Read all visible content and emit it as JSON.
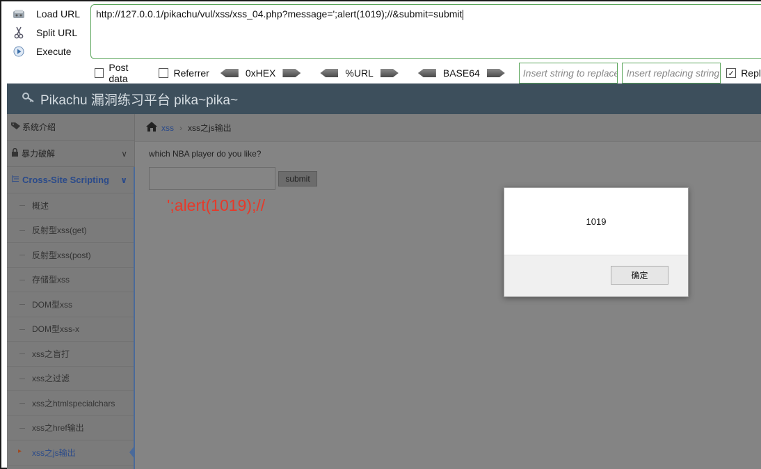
{
  "hackbar": {
    "load_url": "Load URL",
    "split_url": "Split URL",
    "execute": "Execute",
    "url_value": "http://127.0.0.1/pikachu/vul/xss/xss_04.php?message=';alert(1019);//&submit=submit",
    "post_data": "Post data",
    "referrer": "Referrer",
    "enc_hex": "0xHEX",
    "enc_url": "%URL",
    "enc_base64": "BASE64",
    "insert_string_placeholder": "Insert string to replace",
    "insert_replacing_placeholder": "Insert replacing string",
    "replace_label": "Repl",
    "replace_checked": true,
    "post_data_checked": false,
    "referrer_checked": false
  },
  "app": {
    "title": "Pikachu 漏洞练习平台 pika~pika~"
  },
  "sidebar": {
    "items": [
      {
        "label": "系统介绍"
      },
      {
        "label": "暴力破解"
      },
      {
        "label": "Cross-Site Scripting"
      }
    ],
    "sub_items": [
      {
        "label": "概述"
      },
      {
        "label": "反射型xss(get)"
      },
      {
        "label": "反射型xss(post)"
      },
      {
        "label": "存储型xss"
      },
      {
        "label": "DOM型xss"
      },
      {
        "label": "DOM型xss-x"
      },
      {
        "label": "xss之盲打"
      },
      {
        "label": "xss之过滤"
      },
      {
        "label": "xss之htmlspecialchars"
      },
      {
        "label": "xss之href输出"
      },
      {
        "label": "xss之js输出"
      }
    ]
  },
  "main": {
    "breadcrumb_link": "xss",
    "breadcrumb_current": "xss之js输出",
    "question": "which NBA player do you like?",
    "submit_label": "submit",
    "output_text": "';alert(1019);//"
  },
  "dialog": {
    "message": "1019",
    "ok_label": "确定"
  }
}
